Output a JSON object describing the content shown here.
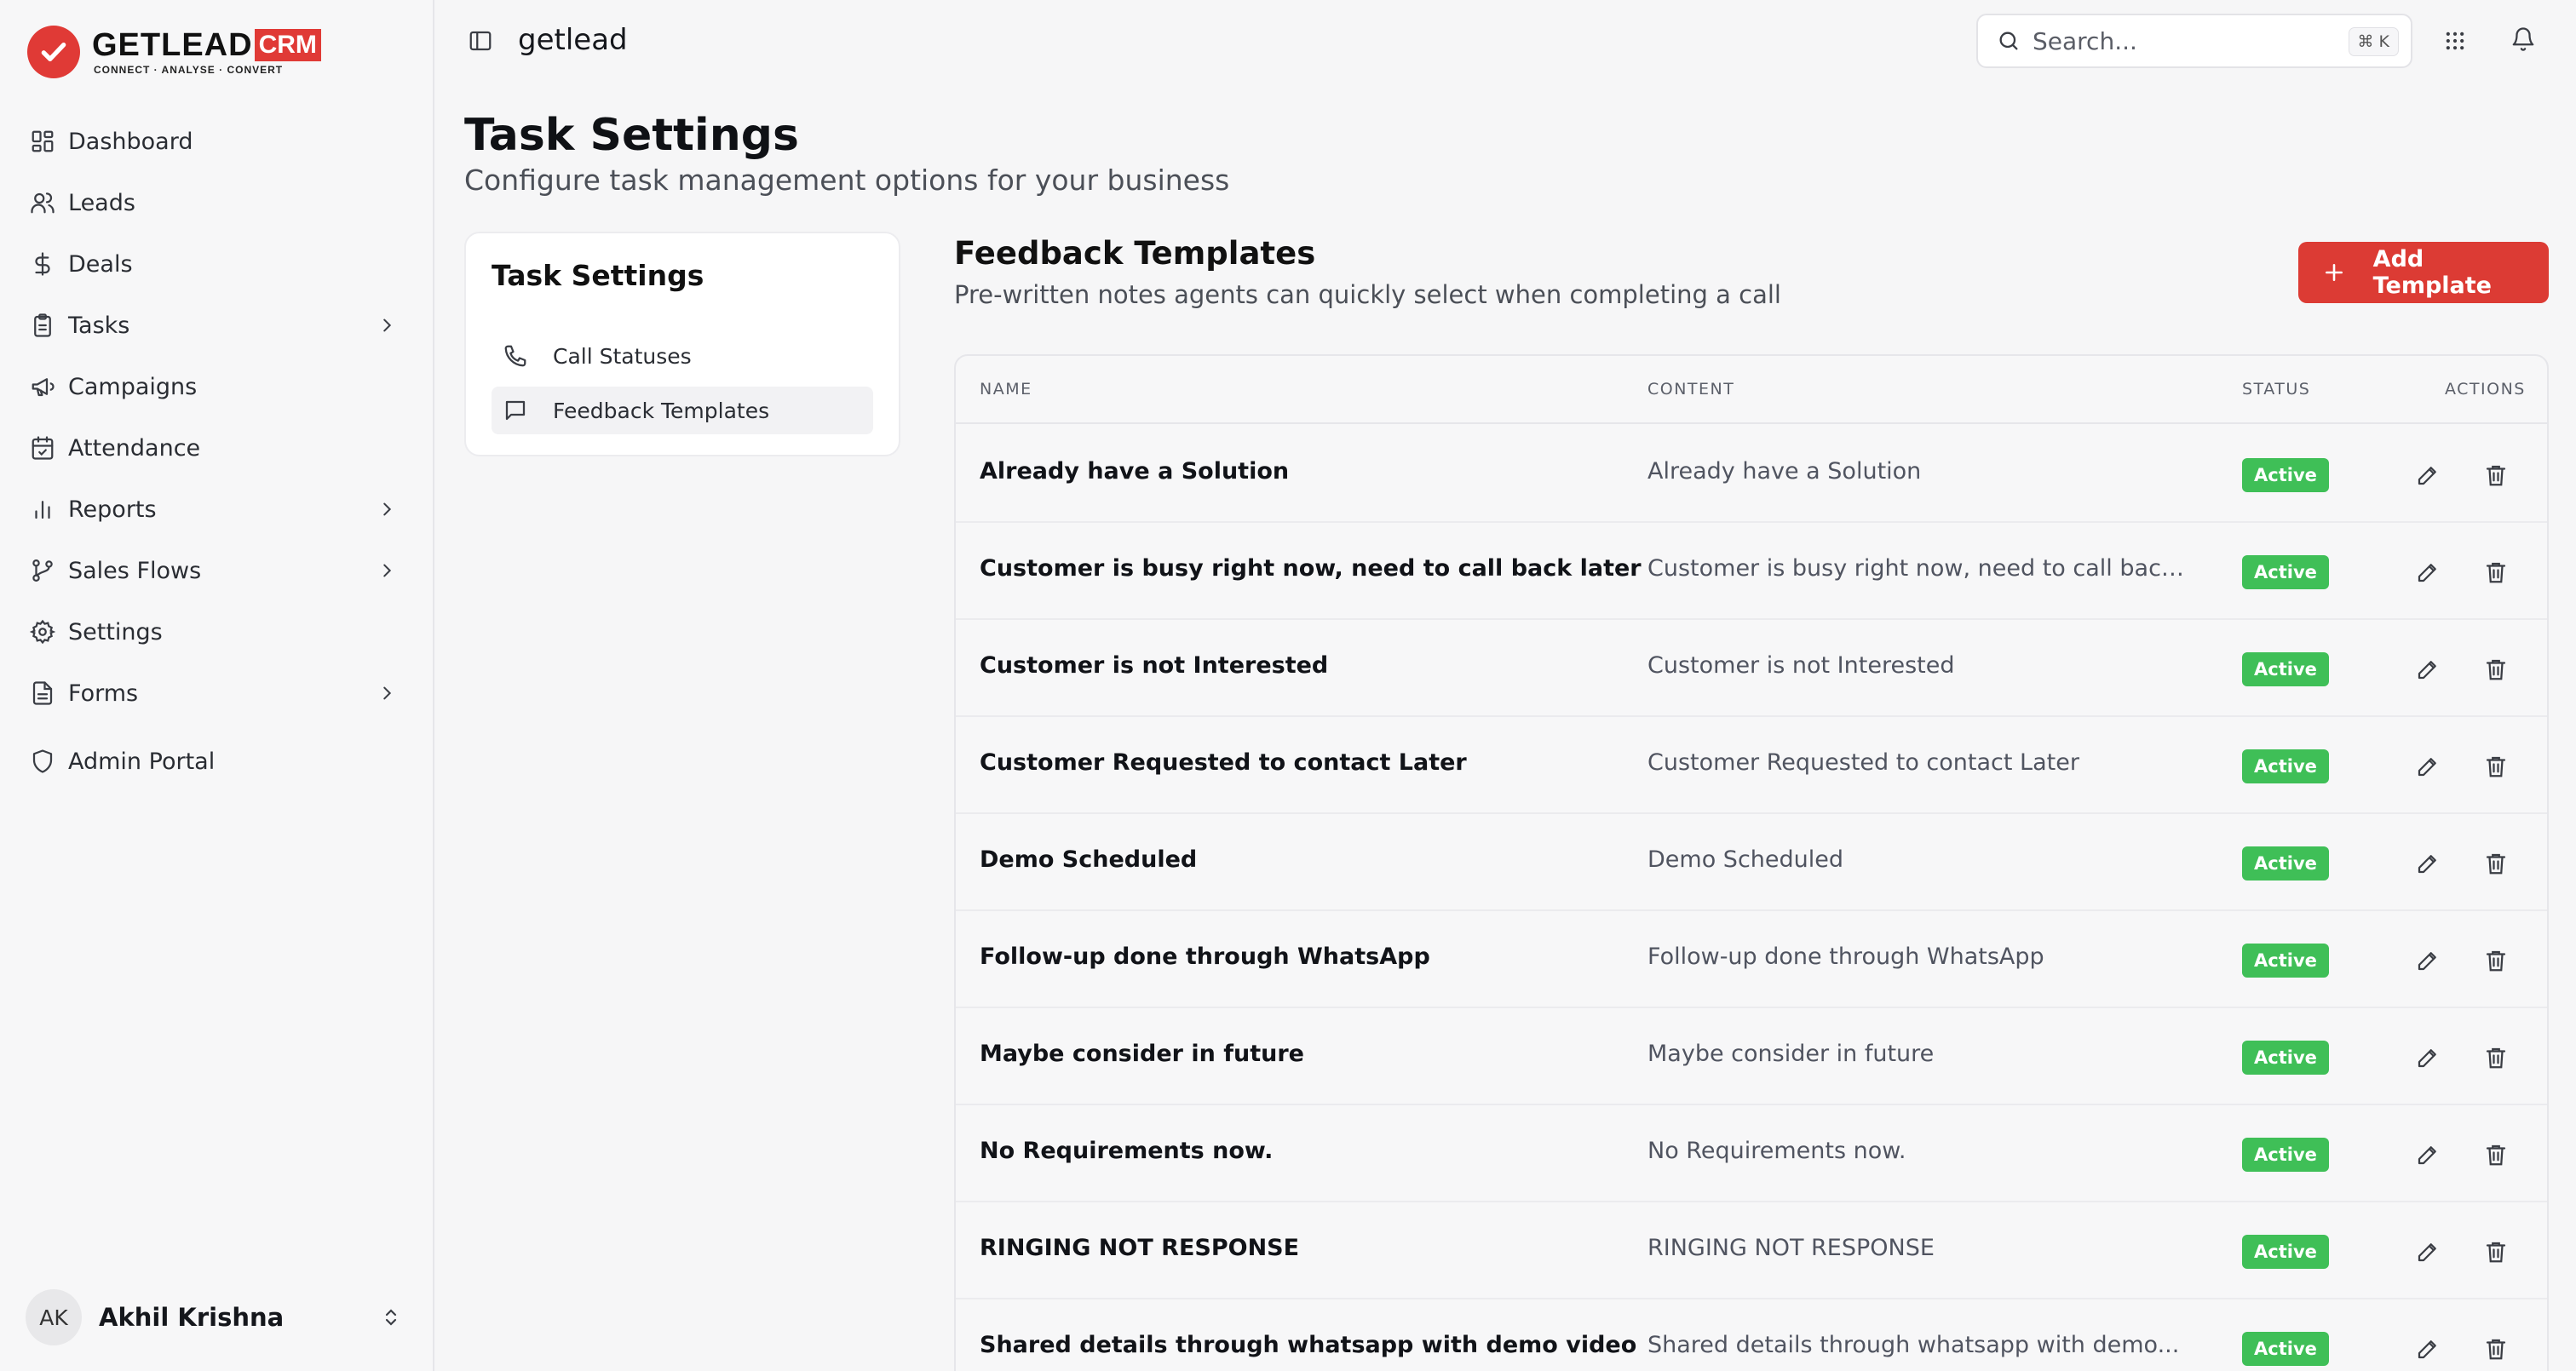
{
  "brand": {
    "name": "GETLEAD",
    "badge": "CRM",
    "tagline": "CONNECT · ANALYSE · CONVERT"
  },
  "sidebar": {
    "items": [
      {
        "label": "Dashboard",
        "icon": "dashboard-icon",
        "has_children": false
      },
      {
        "label": "Leads",
        "icon": "users-icon",
        "has_children": false
      },
      {
        "label": "Deals",
        "icon": "dollar-icon",
        "has_children": false
      },
      {
        "label": "Tasks",
        "icon": "clipboard-icon",
        "has_children": true
      },
      {
        "label": "Campaigns",
        "icon": "megaphone-icon",
        "has_children": false
      },
      {
        "label": "Attendance",
        "icon": "calendar-check-icon",
        "has_children": false
      },
      {
        "label": "Reports",
        "icon": "bar-chart-icon",
        "has_children": true
      },
      {
        "label": "Sales Flows",
        "icon": "git-branch-icon",
        "has_children": true
      },
      {
        "label": "Settings",
        "icon": "gear-icon",
        "has_children": false
      },
      {
        "label": "Forms",
        "icon": "file-text-icon",
        "has_children": true
      },
      {
        "label": "Admin Portal",
        "icon": "shield-icon",
        "has_children": false
      }
    ],
    "user": {
      "initials": "AK",
      "name": "Akhil Krishna"
    }
  },
  "topbar": {
    "org_name": "getlead",
    "search_placeholder": "Search...",
    "search_shortcut": "⌘ K"
  },
  "page": {
    "title": "Task Settings",
    "subtitle": "Configure task management options for your business"
  },
  "settings_menu": {
    "title": "Task Settings",
    "items": [
      {
        "label": "Call Statuses",
        "icon": "phone-icon",
        "active": false
      },
      {
        "label": "Feedback Templates",
        "icon": "message-square-icon",
        "active": true
      }
    ]
  },
  "feedback": {
    "title": "Feedback Templates",
    "subtitle": "Pre-written notes agents can quickly select when completing a call",
    "add_label": "Add Template",
    "columns": {
      "name": "NAME",
      "content": "CONTENT",
      "status": "STATUS",
      "actions": "ACTIONS"
    },
    "rows": [
      {
        "name": "Already have a Solution",
        "content": "Already have a Solution",
        "status": "Active"
      },
      {
        "name": "Customer is busy right now, need to call back later",
        "content": "Customer is busy right now, need to call back...",
        "status": "Active"
      },
      {
        "name": "Customer is not Interested",
        "content": "Customer is not Interested",
        "status": "Active"
      },
      {
        "name": "Customer Requested to contact Later",
        "content": "Customer Requested to contact Later",
        "status": "Active"
      },
      {
        "name": "Demo Scheduled",
        "content": "Demo Scheduled",
        "status": "Active"
      },
      {
        "name": "Follow-up done through WhatsApp",
        "content": "Follow-up done through WhatsApp",
        "status": "Active"
      },
      {
        "name": "Maybe consider in future",
        "content": "Maybe consider in future",
        "status": "Active"
      },
      {
        "name": "No Requirements now.",
        "content": "No Requirements now.",
        "status": "Active"
      },
      {
        "name": "RINGING NOT RESPONSE",
        "content": "RINGING NOT RESPONSE",
        "status": "Active"
      },
      {
        "name": "Shared details through whatsapp with demo video",
        "content": "Shared details through whatsapp with demo...",
        "status": "Active"
      }
    ]
  },
  "colors": {
    "accent": "#dc3b34",
    "status_active": "#3fbf57",
    "background": "#f6f6f7"
  }
}
